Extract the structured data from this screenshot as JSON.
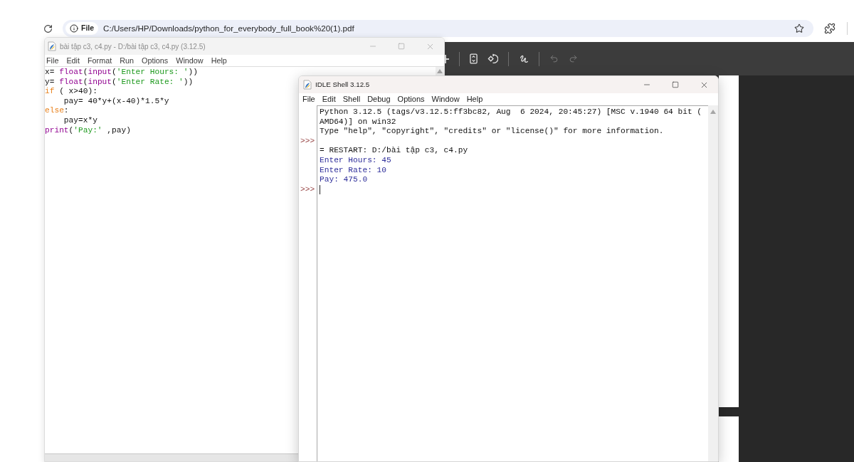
{
  "browser": {
    "address_bar": {
      "security_chip": "File",
      "url": "C:/Users/HP/Downloads/python_for_everybody_full_book%20(1).pdf"
    },
    "pdf_toolbar": {
      "groups": [
        [
          {
            "kind": "plus",
            "disabled": false
          }
        ],
        [
          {
            "kind": "fit",
            "disabled": false
          },
          {
            "kind": "rotate",
            "disabled": false
          }
        ],
        [
          {
            "kind": "draw",
            "disabled": false
          }
        ],
        [
          {
            "kind": "undo",
            "disabled": true
          },
          {
            "kind": "redo",
            "disabled": true
          }
        ]
      ]
    }
  },
  "editor_window": {
    "title": "bài tập c3, c4.py - D:/bài tập c3, c4.py (3.12.5)",
    "active": false,
    "menu": [
      "File",
      "Edit",
      "Format",
      "Run",
      "Options",
      "Window",
      "Help"
    ],
    "lines": [
      {
        "tokens": [
          {
            "text": "x= ",
            "kind": "plain"
          },
          {
            "text": "float",
            "kind": "builtin"
          },
          {
            "text": "(",
            "kind": "plain"
          },
          {
            "text": "input",
            "kind": "builtin"
          },
          {
            "text": "(",
            "kind": "plain"
          },
          {
            "text": "'Enter Hours: '",
            "kind": "string"
          },
          {
            "text": "))",
            "kind": "plain"
          }
        ]
      },
      {
        "tokens": [
          {
            "text": "y= ",
            "kind": "plain"
          },
          {
            "text": "float",
            "kind": "builtin"
          },
          {
            "text": "(",
            "kind": "plain"
          },
          {
            "text": "input",
            "kind": "builtin"
          },
          {
            "text": "(",
            "kind": "plain"
          },
          {
            "text": "'Enter Rate: '",
            "kind": "string"
          },
          {
            "text": "))",
            "kind": "plain"
          }
        ]
      },
      {
        "tokens": [
          {
            "text": "if",
            "kind": "keyword"
          },
          {
            "text": " ( x>40):",
            "kind": "plain"
          }
        ]
      },
      {
        "tokens": [
          {
            "text": "    pay= 40*y+(x-40)*1.5*y",
            "kind": "plain"
          }
        ]
      },
      {
        "tokens": [
          {
            "text": "else",
            "kind": "keyword"
          },
          {
            "text": ":",
            "kind": "plain"
          }
        ]
      },
      {
        "tokens": [
          {
            "text": "    pay=x*y",
            "kind": "plain"
          }
        ]
      },
      {
        "tokens": [
          {
            "text": "print",
            "kind": "builtin"
          },
          {
            "text": "(",
            "kind": "plain"
          },
          {
            "text": "'Pay:'",
            "kind": "string"
          },
          {
            "text": " ,pay)",
            "kind": "plain"
          }
        ]
      }
    ]
  },
  "shell_window": {
    "title": "IDLE Shell 3.12.5",
    "active": true,
    "menu": [
      "File",
      "Edit",
      "Shell",
      "Debug",
      "Options",
      "Window",
      "Help"
    ],
    "lines": [
      {
        "cursor": false,
        "tokens": [
          {
            "text": "Python 3.12.5 (tags/v3.12.5:ff3bc82, Aug  6 2024, 20:45:27) [MSC v.1940 64 bit (",
            "kind": "plain"
          }
        ]
      },
      {
        "cursor": false,
        "tokens": [
          {
            "text": "AMD64)] on win32",
            "kind": "plain"
          }
        ]
      },
      {
        "cursor": false,
        "tokens": [
          {
            "text": "Type \"help\", \"copyright\", \"credits\" or \"license()\" for more information.",
            "kind": "plain"
          }
        ]
      },
      {
        "cursor": false,
        "prompt": ">>>"
      },
      {
        "cursor": false,
        "tokens": [
          {
            "text": "= RESTART: D:/bài tập c3, c4.py",
            "kind": "plain"
          }
        ]
      },
      {
        "cursor": false,
        "tokens": [
          {
            "text": "Enter Hours: 45",
            "kind": "output"
          }
        ]
      },
      {
        "cursor": false,
        "tokens": [
          {
            "text": "Enter Rate: 10",
            "kind": "output"
          }
        ]
      },
      {
        "cursor": false,
        "tokens": [
          {
            "text": "Pay: 475.0",
            "kind": "output"
          }
        ]
      },
      {
        "cursor": true,
        "prompt": ">>>"
      }
    ]
  }
}
